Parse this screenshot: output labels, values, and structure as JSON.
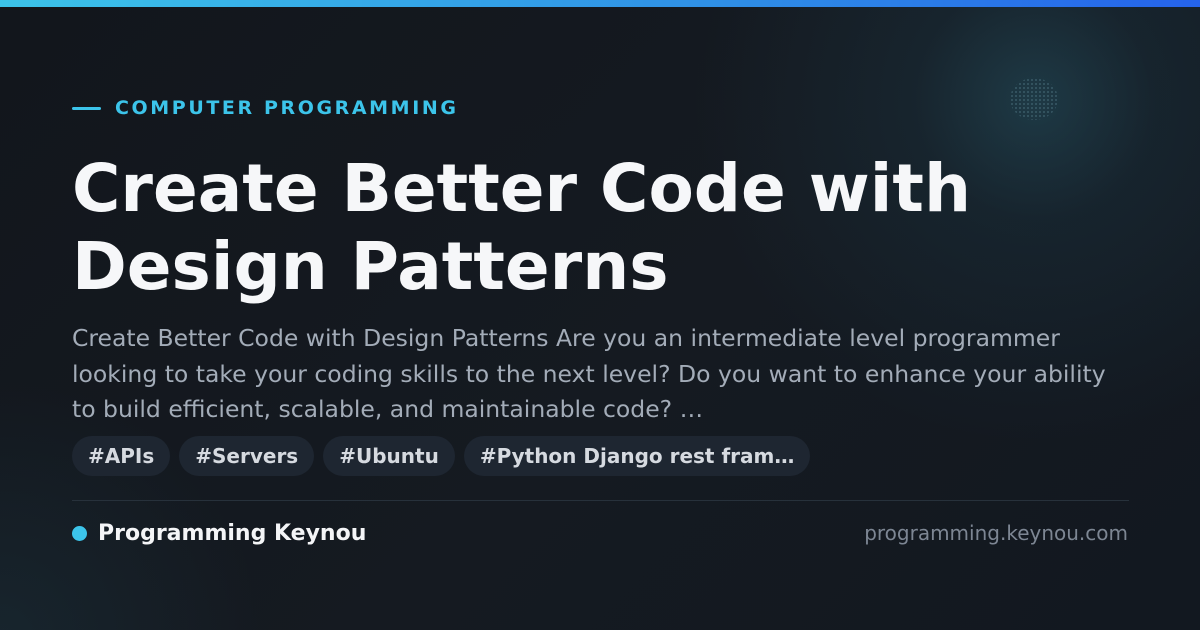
{
  "accent_colors": {
    "primary": "#3cc4ea",
    "gradient_end": "#2563eb",
    "background": "#12161d"
  },
  "category": {
    "label": "COMPUTER PROGRAMMING"
  },
  "post": {
    "title": "Create Better Code with Design Patterns",
    "description": "Create Better Code with Design Patterns Are you an intermediate level programmer looking to take your coding skills to the next level? Do you want to enhance your ability to build efficient, scalable, and maintainable code? …"
  },
  "tags": [
    "#APIs",
    "#Servers",
    "#Ubuntu",
    "#Python Django rest fram…"
  ],
  "footer": {
    "brand_name": "Programming Keynou",
    "site_url": "programming.keynou.com"
  }
}
